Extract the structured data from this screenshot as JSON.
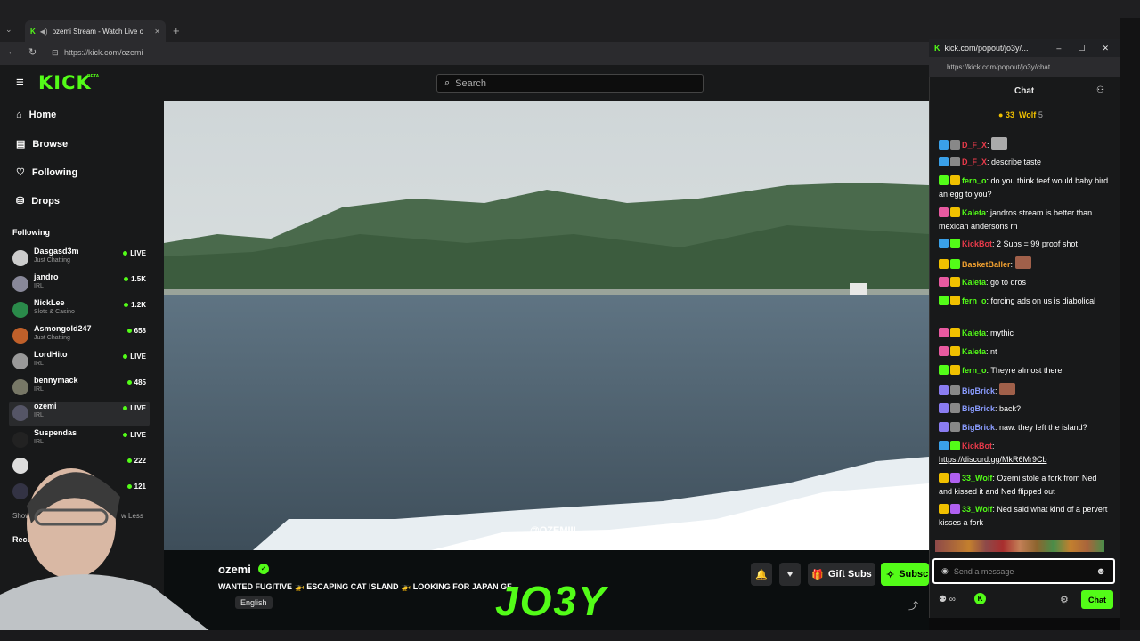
{
  "browser": {
    "tab_title": "ozemi Stream - Watch Live o",
    "url": "https://kick.com/ozemi"
  },
  "site": {
    "logo": "KICK",
    "logo_beta": "BETA",
    "search_placeholder": "Search"
  },
  "sidebar": {
    "nav": [
      {
        "label": "Home",
        "icon": "home-icon"
      },
      {
        "label": "Browse",
        "icon": "browse-icon"
      },
      {
        "label": "Following",
        "icon": "heart-icon"
      },
      {
        "label": "Drops",
        "icon": "drops-icon"
      }
    ],
    "following_heading": "Following",
    "following": [
      {
        "name": "Dasgasd3m",
        "category": "Just Chatting",
        "status": "LIVE"
      },
      {
        "name": "jandro",
        "category": "IRL",
        "status": "1.5K"
      },
      {
        "name": "NickLee",
        "category": "Slots & Casino",
        "status": "1.2K"
      },
      {
        "name": "Asmongold247",
        "category": "Just Chatting",
        "status": "658"
      },
      {
        "name": "LordHito",
        "category": "IRL",
        "status": "LIVE"
      },
      {
        "name": "bennymack",
        "category": "IRL",
        "status": "485"
      },
      {
        "name": "ozemi",
        "category": "IRL",
        "status": "LIVE"
      },
      {
        "name": "Suspendas",
        "category": "IRL",
        "status": "LIVE"
      },
      {
        "name": "",
        "category": "",
        "status": "222"
      },
      {
        "name": "",
        "category": "",
        "status": "121"
      }
    ],
    "show_more": "Show Mo",
    "show_less": "w Less",
    "recommended": "Recon"
  },
  "video": {
    "watermark": "@OZEMIII"
  },
  "stream": {
    "streamer": "ozemi",
    "title": "WANTED FUGITIVE 🚁 ESCAPING CAT ISLAND 🚁 LOOKING FOR JAPAN GF",
    "language": "English",
    "gift_subs": "Gift Subs",
    "subscribe": "Subsc",
    "overlay_brand": "JO3Y"
  },
  "chat": {
    "popout_title": "kick.com/popout/jo3y/...",
    "popout_url": "https://kick.com/popout/jo3y/chat",
    "header": "Chat",
    "pinned_user": "33_Wolf",
    "pinned_count": "5",
    "messages": [
      {
        "user": "D_F_X",
        "color": "#e83a4a",
        "text": "",
        "badges": [
          "#3aa0e8",
          "#888"
        ]
      },
      {
        "user": "D_F_X",
        "color": "#e83a4a",
        "text": "describe taste",
        "badges": [
          "#3aa0e8",
          "#888"
        ]
      },
      {
        "user": "fern_o",
        "color": "#53fc18",
        "text": "do you think feef would baby bird an egg to you?",
        "badges": [
          "#53fc18",
          "#f0c000"
        ]
      },
      {
        "user": "Kaleta",
        "color": "#53fc18",
        "text": "jandros stream is better than mexican andersons rn",
        "badges": [
          "#e85aa0",
          "#f0c000"
        ]
      },
      {
        "user": "KickBot",
        "color": "#e83a4a",
        "text": "2 Subs = 99 proof shot",
        "badges": [
          "#3aa0e8",
          "#53fc18"
        ]
      },
      {
        "user": "BasketBaller",
        "color": "#f0a030",
        "text": "",
        "badges": [
          "#f0c000",
          "#53fc18"
        ]
      },
      {
        "user": "Kaleta",
        "color": "#53fc18",
        "text": "go to dros",
        "badges": [
          "#e85aa0",
          "#f0c000"
        ]
      },
      {
        "user": "fern_o",
        "color": "#53fc18",
        "text": "forcing ads on us is diabolical",
        "badges": [
          "#53fc18",
          "#f0c000"
        ]
      },
      {
        "user": "Kaleta",
        "color": "#53fc18",
        "text": "mythic",
        "badges": [
          "#e85aa0",
          "#f0c000"
        ]
      },
      {
        "user": "Kaleta",
        "color": "#53fc18",
        "text": "nt",
        "badges": [
          "#e85aa0",
          "#f0c000"
        ]
      },
      {
        "user": "fern_o",
        "color": "#53fc18",
        "text": "Theyre almost there",
        "badges": [
          "#53fc18",
          "#f0c000"
        ]
      },
      {
        "user": "BigBrick",
        "color": "#8a9cff",
        "text": "",
        "badges": [
          "#8a7cf0",
          "#888"
        ]
      },
      {
        "user": "BigBrick",
        "color": "#8a9cff",
        "text": "back?",
        "badges": [
          "#8a7cf0",
          "#888"
        ]
      },
      {
        "user": "BigBrick",
        "color": "#8a9cff",
        "text": "naw. they left the island?",
        "badges": [
          "#8a7cf0",
          "#888"
        ]
      },
      {
        "user": "KickBot",
        "color": "#e83a4a",
        "text": "https://discord.gg/MkR6Mr9Cb",
        "badges": [
          "#3aa0e8",
          "#53fc18"
        ]
      },
      {
        "user": "33_Wolf",
        "color": "#53fc18",
        "text": "Ozemi stole a fork from Ned and kissed it and Ned flipped out",
        "badges": [
          "#f0c000",
          "#b060f0"
        ]
      },
      {
        "user": "33_Wolf",
        "color": "#53fc18",
        "text": "Ned said what kind of a pervert kisses a fork",
        "badges": [
          "#f0c000",
          "#b060f0"
        ]
      }
    ],
    "input_placeholder": "Send a message",
    "send_label": "Chat"
  },
  "colors": {
    "accent": "#53fc18"
  }
}
